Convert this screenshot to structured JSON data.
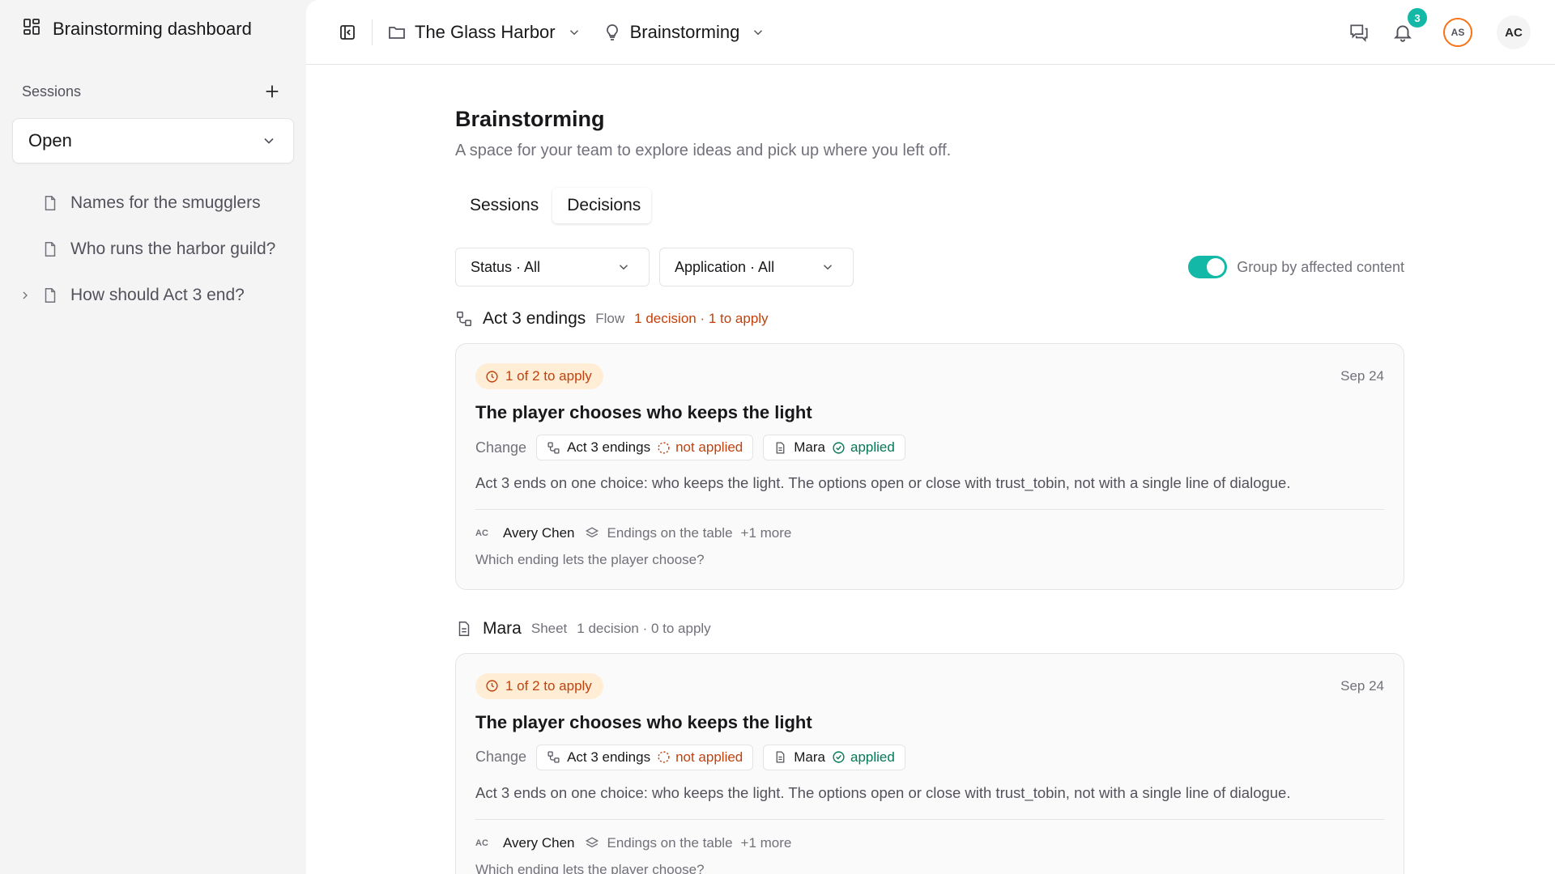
{
  "sidebar": {
    "title": "Brainstorming dashboard",
    "sessions_label": "Sessions",
    "filter_value": "Open",
    "items": [
      {
        "label": "Names for the smugglers",
        "has_children": false
      },
      {
        "label": "Who runs the harbor guild?",
        "has_children": false
      },
      {
        "label": "How should Act 3 end?",
        "has_children": true
      }
    ]
  },
  "topbar": {
    "project": "The Glass Harbor",
    "section": "Brainstorming",
    "notification_count": "3",
    "avatars": [
      "AS",
      "AC"
    ]
  },
  "page": {
    "title": "Brainstorming",
    "subtitle": "A space for your team to explore ideas and pick up where you left off.",
    "tabs": [
      "Sessions",
      "Decisions"
    ],
    "active_tab": "Decisions"
  },
  "filters": {
    "status": "Status · All",
    "application": "Application · All",
    "group_toggle_label": "Group by affected content",
    "group_toggle_on": true
  },
  "groups": [
    {
      "name": "Act 3 endings",
      "type": "Flow",
      "count": "1 decision · 1 to apply",
      "card": {
        "pill": "1 of 2 to apply",
        "date": "Sep 24",
        "title": "The player chooses who keeps the light",
        "change_label": "Change",
        "chip1_name": "Act 3 endings",
        "chip1_status": "not applied",
        "chip2_name": "Mara",
        "chip2_status": "applied",
        "description": "Act 3 ends on one choice: who keeps the light. The options open or close with trust_tobin, not with a single line of dialogue.",
        "author_initials": "AC",
        "author": "Avery Chen",
        "context": "Endings on the table",
        "more": "+1 more",
        "question": "Which ending lets the player choose?"
      }
    },
    {
      "name": "Mara",
      "type": "Sheet",
      "count": "1 decision · 0 to apply",
      "card": {
        "pill": "1 of 2 to apply",
        "date": "Sep 24",
        "title": "The player chooses who keeps the light",
        "change_label": "Change",
        "chip1_name": "Act 3 endings",
        "chip1_status": "not applied",
        "chip2_name": "Mara",
        "chip2_status": "applied",
        "description": "Act 3 ends on one choice: who keeps the light. The options open or close with trust_tobin, not with a single line of dialogue.",
        "author_initials": "AC",
        "author": "Avery Chen",
        "context": "Endings on the table",
        "more": "+1 more",
        "question": "Which ending lets the player choose?"
      }
    }
  ],
  "colors": {
    "accent": "#14b8a6",
    "warning": "#c2410c",
    "warning_bg": "#ffedd5",
    "success": "#047857"
  }
}
